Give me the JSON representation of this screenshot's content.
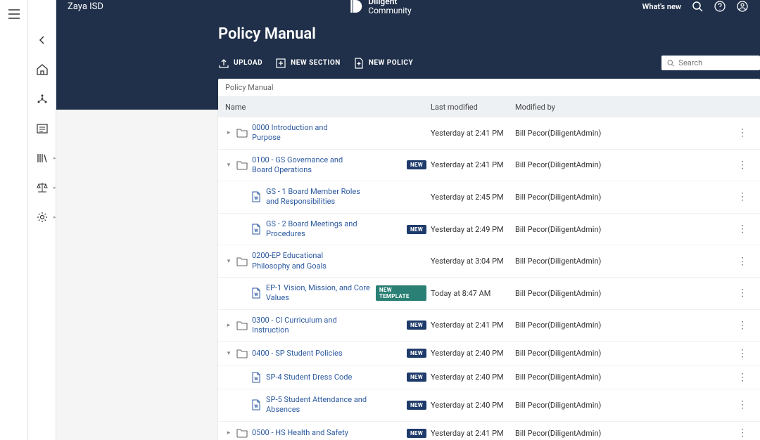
{
  "org": "Zaya ISD",
  "brand": {
    "line1": "Diligent",
    "line2": "Community"
  },
  "topbar": {
    "whats_new": "What's new"
  },
  "page_title": "Policy Manual",
  "actions": {
    "upload": "UPLOAD",
    "new_section": "NEW SECTION",
    "new_policy": "NEW POLICY"
  },
  "search": {
    "placeholder": "Search"
  },
  "breadcrumb": "Policy Manual",
  "columns": {
    "name": "Name",
    "modified": "Last modified",
    "by": "Modified by"
  },
  "badges": {
    "new": "NEW",
    "new_template": "NEW TEMPLATE"
  },
  "rows": [
    {
      "type": "folder",
      "caret": "right",
      "indent": 0,
      "name": "0000 Introduction and Purpose",
      "badge": "",
      "modified": "Yesterday at 2:41 PM",
      "by": "Bill Pecor(DiligentAdmin)"
    },
    {
      "type": "folder",
      "caret": "down",
      "indent": 0,
      "name": "0100 - GS Governance and Board Operations",
      "badge": "new",
      "modified": "Yesterday at 2:41 PM",
      "by": "Bill Pecor(DiligentAdmin)"
    },
    {
      "type": "doc",
      "caret": "",
      "indent": 1,
      "name": "GS - 1 Board Member Roles and Responsibilities",
      "badge": "",
      "modified": "Yesterday at 2:45 PM",
      "by": "Bill Pecor(DiligentAdmin)"
    },
    {
      "type": "doc",
      "caret": "",
      "indent": 1,
      "name": "GS - 2 Board Meetings and Procedures",
      "badge": "new",
      "modified": "Yesterday at 2:49 PM",
      "by": "Bill Pecor(DiligentAdmin)"
    },
    {
      "type": "folder",
      "caret": "down",
      "indent": 0,
      "name": "0200-EP Educational Philosophy and Goals",
      "badge": "",
      "modified": "Yesterday at 3:04 PM",
      "by": "Bill Pecor(DiligentAdmin)"
    },
    {
      "type": "doc",
      "caret": "",
      "indent": 1,
      "name": "EP-1 Vision, Mission, and Core Values",
      "badge": "new_template",
      "modified": "Today at 8:47 AM",
      "by": "Bill Pecor(DiligentAdmin)"
    },
    {
      "type": "folder",
      "caret": "right",
      "indent": 0,
      "name": "0300 - CI Curriculum and Instruction",
      "badge": "new",
      "modified": "Yesterday at 2:41 PM",
      "by": "Bill Pecor(DiligentAdmin)"
    },
    {
      "type": "folder",
      "caret": "down",
      "indent": 0,
      "name": "0400 - SP Student Policies",
      "badge": "new",
      "modified": "Yesterday at 2:40 PM",
      "by": "Bill Pecor(DiligentAdmin)"
    },
    {
      "type": "doc",
      "caret": "",
      "indent": 1,
      "name": "SP-4 Student Dress Code",
      "badge": "new",
      "modified": "Yesterday at 2:40 PM",
      "by": "Bill Pecor(DiligentAdmin)"
    },
    {
      "type": "doc",
      "caret": "",
      "indent": 1,
      "name": "SP-5 Student Attendance and Absences",
      "badge": "new",
      "modified": "Yesterday at 2:40 PM",
      "by": "Bill Pecor(DiligentAdmin)"
    },
    {
      "type": "folder",
      "caret": "right",
      "indent": 0,
      "name": "0500 - HS Health and Safety",
      "badge": "new",
      "modified": "Yesterday at 2:41 PM",
      "by": "Bill Pecor(DiligentAdmin)"
    }
  ]
}
